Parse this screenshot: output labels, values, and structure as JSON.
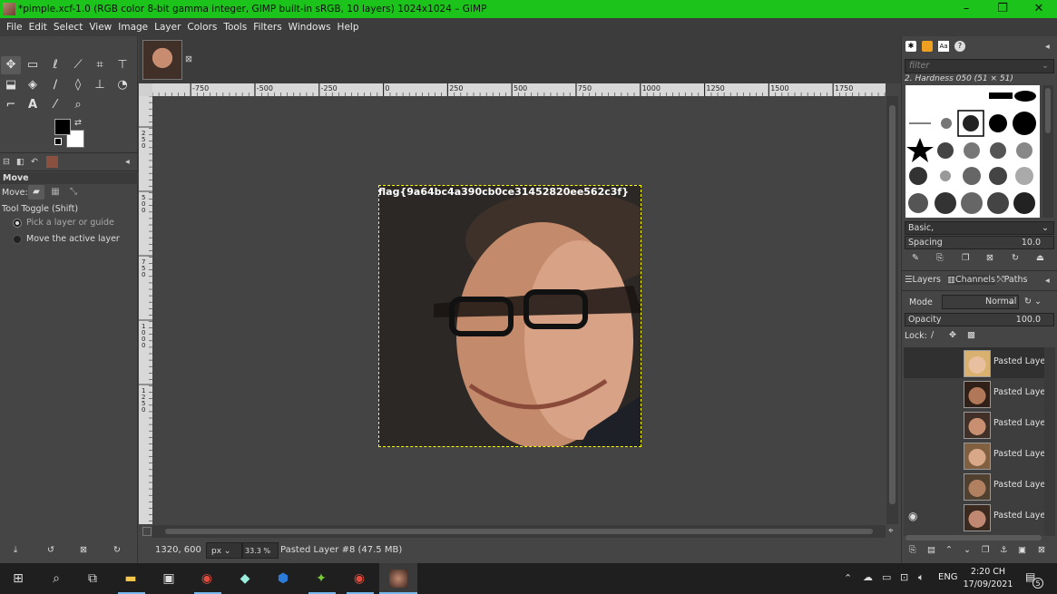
{
  "window": {
    "title": "*pimple.xcf-1.0 (RGB color 8-bit gamma integer, GIMP built-in sRGB, 10 layers) 1024x1024 – GIMP",
    "controls": [
      "–",
      "❐",
      "✕"
    ]
  },
  "menu": [
    "File",
    "Edit",
    "Select",
    "View",
    "Image",
    "Layer",
    "Colors",
    "Tools",
    "Filters",
    "Windows",
    "Help"
  ],
  "tool_options": {
    "title": "Move",
    "move_label": "Move:",
    "toggle_label": "Tool Toggle  (Shift)",
    "option1": "Pick a layer or guide",
    "option2": "Move the active layer"
  },
  "ruler_top": [
    "-750",
    "-500",
    "-250",
    "0",
    "250",
    "500",
    "750",
    "1000",
    "1250",
    "1500",
    "1750"
  ],
  "ruler_left": [
    "2\n5\n0",
    "5\n0\n0",
    "7\n5\n0",
    "1\n0\n0\n0",
    "1\n2\n5\n0"
  ],
  "canvas": {
    "flag_text": "flag{9a64bc4a390cb0ce31452820ee562c3f}"
  },
  "status": {
    "coords": "1320, 600",
    "unit": "px",
    "zoom": "33.3 %",
    "layer_info": "Pasted Layer #8 (47.5 MB)"
  },
  "brushes": {
    "filter_placeholder": "filter",
    "selected": "2. Hardness 050 (51 × 51)",
    "preset": "Basic,",
    "spacing_label": "Spacing",
    "spacing_value": "10.0"
  },
  "layers_panel": {
    "tabs": [
      "Layers",
      "Channels",
      "Paths"
    ],
    "mode_label": "Mode",
    "mode_value": "Normal",
    "opacity_label": "Opacity",
    "opacity_value": "100.0",
    "lock_label": "Lock:",
    "layers": [
      {
        "name": "Pasted Layer",
        "visible": false,
        "skin": "#e8c0a0",
        "hair": "#d8b070"
      },
      {
        "name": "Pasted Layer",
        "visible": false,
        "skin": "#b07858",
        "hair": "#302018"
      },
      {
        "name": "Pasted Layer",
        "visible": false,
        "skin": "#c89070",
        "hair": "#403028"
      },
      {
        "name": "Pasted Layer",
        "visible": false,
        "skin": "#d8a888",
        "hair": "#806040"
      },
      {
        "name": "Pasted Layer",
        "visible": false,
        "skin": "#b08060",
        "hair": "#504030"
      },
      {
        "name": "Pasted Layer",
        "visible": true,
        "skin": "#c08870",
        "hair": "#3a2a20"
      }
    ]
  },
  "taskbar": {
    "time": "2:20 CH",
    "date": "17/09/2021",
    "lang": "ENG",
    "notifications": "5"
  }
}
